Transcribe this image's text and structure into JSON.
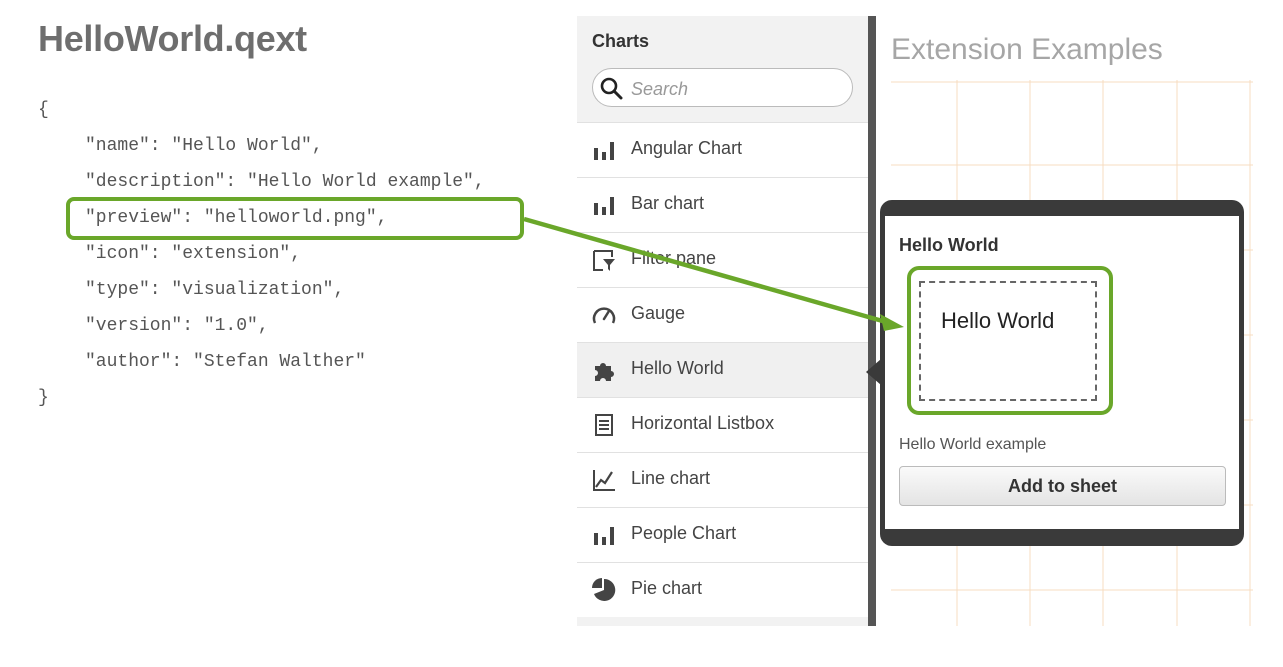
{
  "slide": {
    "title": "HelloWorld.qext"
  },
  "code": {
    "lines": [
      "{",
      "\"name\": \"Hello World\",",
      "\"description\": \"Hello World example\",",
      "\"preview\": \"helloworld.png\",",
      "\"icon\": \"extension\",",
      "\"type\": \"visualization\",",
      "\"version\": \"1.0\",",
      "\"author\": \"Stefan Walther\"",
      "}"
    ],
    "highlighted_line": 3
  },
  "charts_panel": {
    "header": "Charts",
    "search": {
      "placeholder": "Search",
      "value": "",
      "icon": "search-icon"
    },
    "items": [
      {
        "label": "Angular Chart",
        "icon": "bar-chart-icon"
      },
      {
        "label": "Bar chart",
        "icon": "bar-chart-icon"
      },
      {
        "label": "Filter pane",
        "icon": "filter-pane-icon"
      },
      {
        "label": "Gauge",
        "icon": "gauge-icon"
      },
      {
        "label": "Hello World",
        "icon": "extension-puzzle-icon",
        "selected": true
      },
      {
        "label": "Horizontal Listbox",
        "icon": "listbox-icon"
      },
      {
        "label": "Line chart",
        "icon": "line-chart-icon"
      },
      {
        "label": "People Chart",
        "icon": "bar-chart-icon"
      },
      {
        "label": "Pie chart",
        "icon": "pie-chart-icon"
      }
    ]
  },
  "sheet": {
    "title": "Extension Examples"
  },
  "popover": {
    "title": "Hello World",
    "preview_text": "Hello World",
    "description": "Hello World example",
    "add_button": "Add to sheet"
  },
  "colors": {
    "highlight_green": "#6aa72a",
    "grid_line": "#f7dcc0",
    "popover_frame": "#3a3a3a"
  }
}
